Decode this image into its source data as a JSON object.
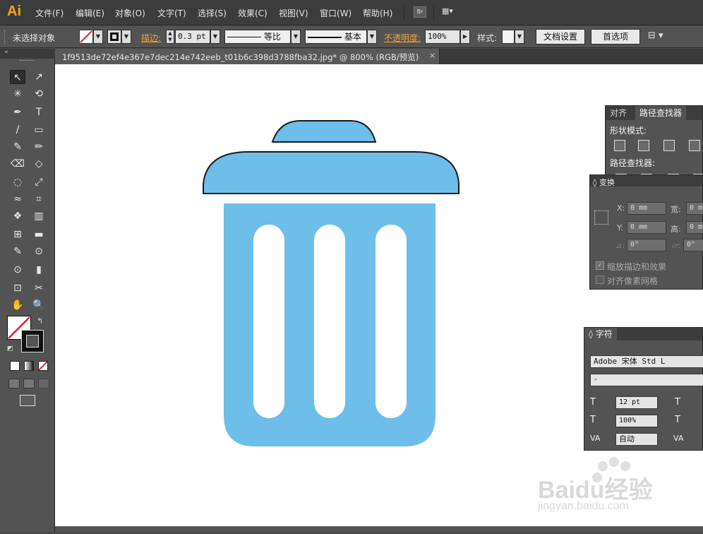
{
  "app": {
    "logo": "Ai"
  },
  "menu": [
    "文件(F)",
    "编辑(E)",
    "对象(O)",
    "文字(T)",
    "选择(S)",
    "效果(C)",
    "视图(V)",
    "窗口(W)",
    "帮助(H)"
  ],
  "menu_extra": {
    "bridge": "Br",
    "workspace": "▦▾"
  },
  "control": {
    "selection": "未选择对象",
    "stroke_label": "描边:",
    "stroke_value": "0.3 pt",
    "stroke_profile": "等比",
    "brush": "基本",
    "opacity_label": "不透明度:",
    "opacity_value": "100%",
    "style_label": "样式:",
    "doc_setup": "文档设置",
    "prefs": "首选项"
  },
  "document": {
    "tab": "1f9513de72ef4e367e7dec214e742eeb_t01b6c398d3788fba32.jpg* @ 800% (RGB/预览)",
    "close": "×"
  },
  "tools": [
    [
      "↖",
      "↗"
    ],
    [
      "✳",
      "⟲"
    ],
    [
      "✒",
      "T"
    ],
    [
      "/",
      "▭"
    ],
    [
      "✎",
      "✏"
    ],
    [
      "⌫",
      "◇"
    ],
    [
      "◌",
      "⤢"
    ],
    [
      "≈",
      "⌗"
    ],
    [
      "❖",
      "▥"
    ],
    [
      "⊞",
      "▬"
    ],
    [
      "✎",
      "⊙"
    ],
    [
      "⊙",
      "▮"
    ],
    [
      "⊡",
      "✂"
    ],
    [
      "✋",
      "🔍"
    ]
  ],
  "pathfinder": {
    "tabs": [
      "对齐",
      "路径查找器"
    ],
    "shape_modes": "形状模式:",
    "pathfinders": "路径查找器:"
  },
  "transform": {
    "title": "变换",
    "x_label": "X:",
    "x_value": "0 mm",
    "y_label": "Y:",
    "y_value": "0 mm",
    "w_label": "宽:",
    "w_value": "0 m",
    "h_label": "高:",
    "h_value": "0 m",
    "angle_value": "0°",
    "shear_value": "0°",
    "scale_strokes": "缩放描边和效果",
    "align_pixel": "对齐像素网格"
  },
  "character": {
    "title": "字符",
    "font": "Adobe 宋体 Std L",
    "style": "-",
    "size": "12 pt",
    "leading": "100%",
    "kerning": "自动"
  },
  "colors": {
    "bin_fill": "#6ebeea",
    "bin_stroke": "#1a1a1a",
    "accent_orange": "#f0a43a"
  },
  "watermark": {
    "brand": "Baidu经验",
    "url": "jingyan.baidu.com"
  }
}
